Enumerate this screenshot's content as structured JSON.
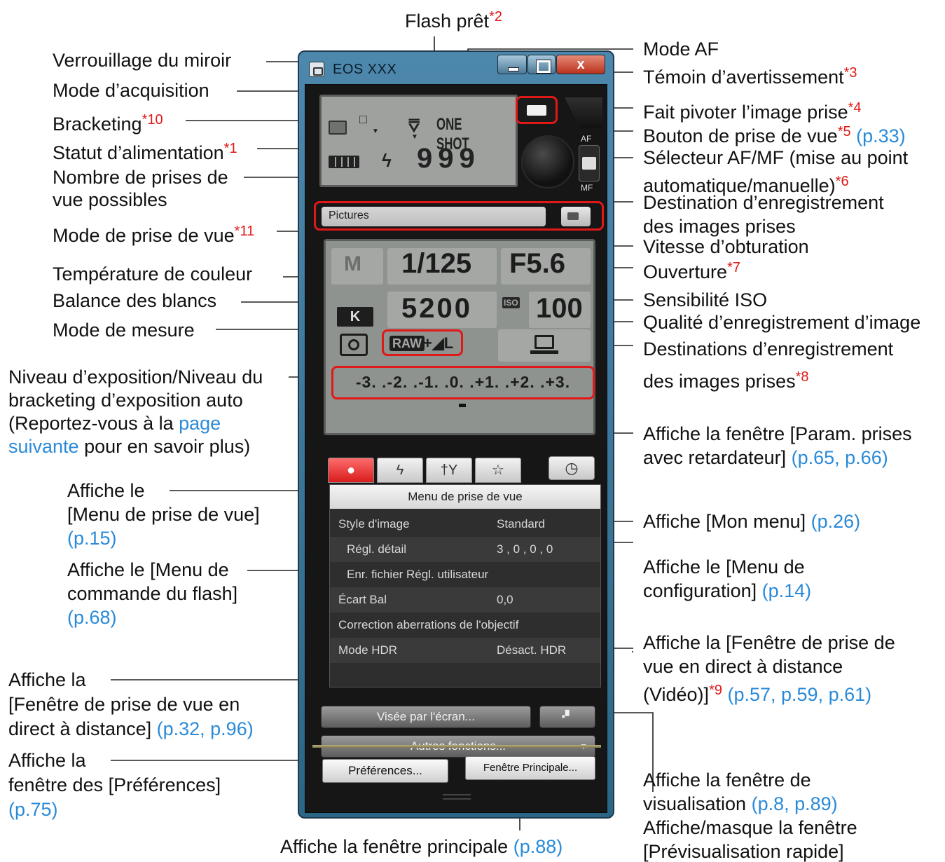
{
  "window": {
    "title": "EOS XXX",
    "close_glyph": "x",
    "lcd_top": {
      "drive_mode_glyph": "□",
      "flash_glyph": "ϟ",
      "af_mode": "ONE SHOT",
      "shots": "999"
    },
    "af_label": "AF",
    "mf_label": "MF",
    "destination_folder": "Pictures",
    "lcd_main": {
      "shooting_mode": "M",
      "shutter_speed": "1/125",
      "aperture": "F5.6",
      "wb_badge": "K",
      "color_temp": "5200",
      "iso_badge": "ISO",
      "iso": "100",
      "quality_raw": "RAW",
      "quality_jpeg": "+◢L",
      "exposure_scale": "-3. .-2. .-1. .0. .+1. .+2. .+3."
    },
    "tabs": [
      {
        "label": "●",
        "active": true
      },
      {
        "label": "ϟ"
      },
      {
        "label": "†Y"
      },
      {
        "label": "☆"
      }
    ],
    "timer_glyph": "◷",
    "menu": {
      "title": "Menu de prise de vue",
      "rows": [
        {
          "key": "Style d'image",
          "value": "Standard"
        },
        {
          "key": "Régl. détail",
          "value": "3 , 0 , 0 , 0"
        },
        {
          "key": "Enr. fichier Régl. utilisateur",
          "value": ""
        },
        {
          "key": "Écart Bal",
          "value": "0,0"
        },
        {
          "key": "Correction aberrations de l'objectif",
          "value": ""
        },
        {
          "key": "Mode HDR",
          "value": "Désact. HDR"
        }
      ]
    },
    "live_view_button": "Visée par l'écran...",
    "movie_glyph": "▪▘",
    "other_functions_button": "Autres fonctions...",
    "other_functions_arrow": "▼",
    "preferences_button": "Préférences...",
    "main_window_button": "Fenêtre Principale..."
  },
  "labels": {
    "flash_ready": {
      "text": "Flash prêt",
      "star": "*2"
    },
    "mirror_lockup": {
      "text": "Verrouillage du miroir"
    },
    "drive_mode": {
      "text": "Mode d’acquisition"
    },
    "bracketing": {
      "text": "Bracketing",
      "star": "*10"
    },
    "power_status": {
      "text": "Statut d’alimentation",
      "star": "*1"
    },
    "shots_possible": {
      "line1": "Nombre de prises de",
      "line2": "vue possibles"
    },
    "shooting_mode": {
      "text": "Mode de prise de vue",
      "star": "*11"
    },
    "color_temp": {
      "text": "Température de couleur"
    },
    "white_balance": {
      "text": "Balance des blancs"
    },
    "metering": {
      "text": "Mode de mesure"
    },
    "exposure_level": {
      "line1": "Niveau d’exposition/Niveau du",
      "line2": "bracketing d’exposition auto",
      "line3": "(Reportez-vous à la ",
      "link1": "page",
      "link2": "suivante",
      "line4_rest": " pour en savoir plus)"
    },
    "shooting_menu": {
      "line1": "Affiche le",
      "line2": "[Menu de prise de vue]",
      "ref": "(p.15)"
    },
    "flash_menu": {
      "line1": "Affiche le [Menu de",
      "line2": "commande du flash]",
      "ref": "(p.68)"
    },
    "remote_live_view": {
      "line1": "Affiche la",
      "line2": "[Fenêtre de prise de vue en",
      "line3": "direct à distance] ",
      "ref": "(p.32, p.96)"
    },
    "preferences": {
      "line1": "Affiche la",
      "line2": "fenêtre des [Préférences]",
      "ref": "(p.75)"
    },
    "main_window": {
      "text": "Affiche la fenêtre principale ",
      "ref": "(p.88)"
    },
    "af_mode": {
      "text": "Mode AF"
    },
    "warning": {
      "text": "Témoin d’avertissement",
      "star": "*3"
    },
    "rotate": {
      "text": "Fait pivoter l’image prise",
      "star": "*4"
    },
    "shutter_button": {
      "text": "Bouton de prise de vue",
      "star": "*5",
      "ref": " (p.33)"
    },
    "afmf_switch": {
      "line1": "Sélecteur AF/MF (mise au point",
      "line2": "automatique/manuelle)",
      "star": "*6"
    },
    "save_destination": {
      "line1": "Destination d’enregistrement",
      "line2": "des images prises"
    },
    "shutter_speed": {
      "text": "Vitesse d’obturation"
    },
    "aperture": {
      "text": "Ouverture",
      "star": "*7"
    },
    "iso": {
      "text": "Sensibilité ISO"
    },
    "image_quality": {
      "text": "Qualité d’enregistrement d’image"
    },
    "save_destinations": {
      "line1": "Destinations d’enregistrement",
      "line2": "des images prises",
      "star": "*8"
    },
    "timer": {
      "line1": "Affiche la fenêtre [Param. prises",
      "line2": "avec retardateur] ",
      "ref": "(p.65, p.66)"
    },
    "my_menu": {
      "text": "Affiche [Mon menu] ",
      "ref": "(p.26)"
    },
    "setup_menu": {
      "line1": "Affiche le [Menu de",
      "line2": "configuration] ",
      "ref": "(p.14)"
    },
    "remote_movie": {
      "line1": "Affiche la [Fenêtre de prise de",
      "line2": "vue en direct à distance",
      "line3": "(Vidéo)]",
      "star": "*9",
      "ref": " (p.57, p.59, p.61)"
    },
    "viewer": {
      "line1": "Affiche la fenêtre de",
      "line2": "visualisation ",
      "ref": "(p.8, p.89)",
      "line3": "Affiche/masque la fenêtre",
      "line4": "[Prévisualisation rapide]"
    }
  }
}
